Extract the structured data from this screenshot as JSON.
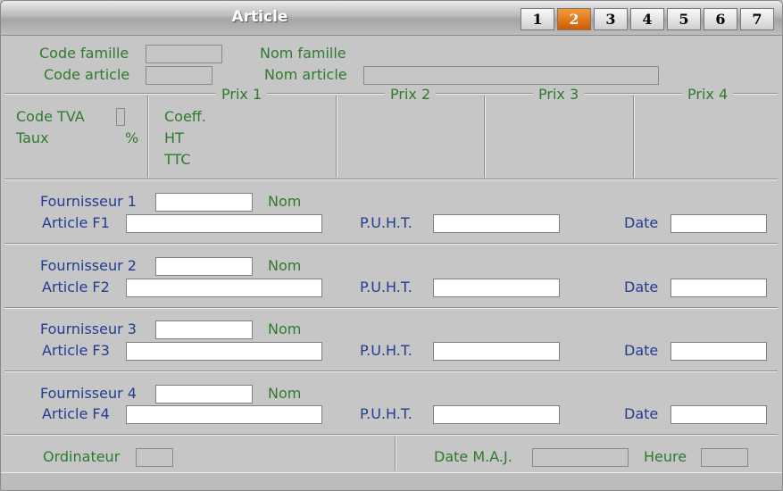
{
  "window": {
    "title": "Article",
    "tabs": [
      "1",
      "2",
      "3",
      "4",
      "5",
      "6",
      "7"
    ],
    "active_tab": "2",
    "accent_color": "#e07010"
  },
  "header": {
    "code_famille_label": "Code famille",
    "nom_famille_label": "Nom famille",
    "code_article_label": "Code article",
    "nom_article_label": "Nom article"
  },
  "pricing": {
    "prix_titles": [
      "Prix 1",
      "Prix 2",
      "Prix 3",
      "Prix 4"
    ],
    "code_tva_label": "Code TVA",
    "taux_label": "Taux",
    "percent_symbol": "%",
    "coeff_label": "Coeff.",
    "ht_label": "HT",
    "ttc_label": "TTC"
  },
  "suppliers": [
    {
      "supplier_label": "Fournisseur 1",
      "nom_label": "Nom",
      "article_label": "Article F1",
      "puht_label": "P.U.H.T.",
      "date_label": "Date"
    },
    {
      "supplier_label": "Fournisseur 2",
      "nom_label": "Nom",
      "article_label": "Article F2",
      "puht_label": "P.U.H.T.",
      "date_label": "Date"
    },
    {
      "supplier_label": "Fournisseur 3",
      "nom_label": "Nom",
      "article_label": "Article F3",
      "puht_label": "P.U.H.T.",
      "date_label": "Date"
    },
    {
      "supplier_label": "Fournisseur 4",
      "nom_label": "Nom",
      "article_label": "Article F4",
      "puht_label": "P.U.H.T.",
      "date_label": "Date"
    }
  ],
  "footer": {
    "ordinateur_label": "Ordinateur",
    "date_maj_label": "Date M.A.J.",
    "heure_label": "Heure"
  }
}
